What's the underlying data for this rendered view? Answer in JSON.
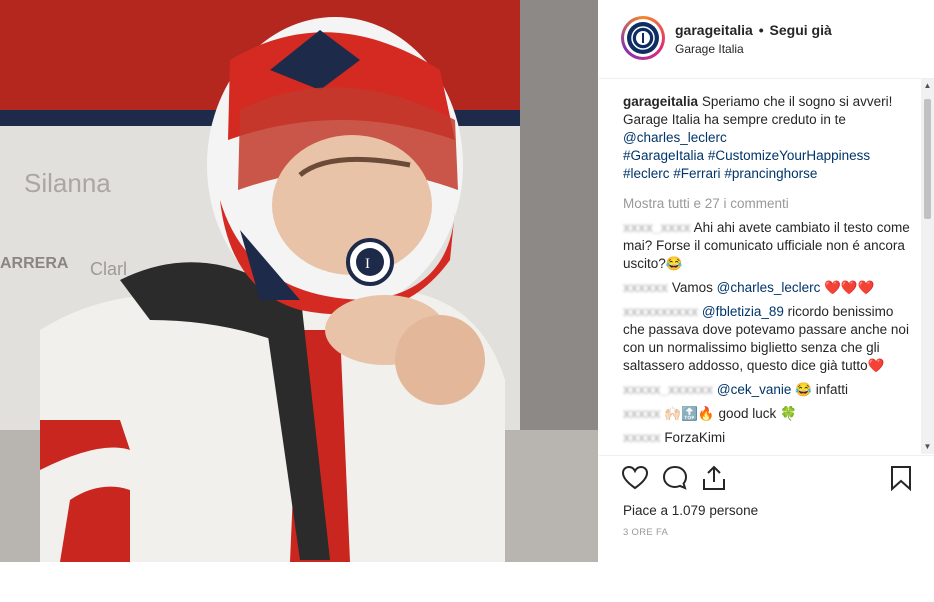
{
  "header": {
    "username": "garageitalia",
    "separator": "•",
    "follow_label": "Segui già",
    "subtitle": "Garage Italia"
  },
  "caption": {
    "username": "garageitalia",
    "text": "Speriamo che il sogno si avveri! Garage Italia ha sempre creduto in te",
    "mention": "@charles_leclerc",
    "hashtags": [
      "#GarageItalia",
      "#CustomizeYourHappiness",
      "#leclerc",
      "#Ferrari",
      "#prancinghorse"
    ]
  },
  "comments": {
    "view_all": "Mostra tutti e 27 i commenti",
    "items": [
      {
        "user": "xxxx_xxxx",
        "text": "Ahi ahi avete cambiato il testo come mai? Forse il comunicato ufficiale non é ancora uscito?😂"
      },
      {
        "user": "xxxxxx",
        "text": "Vamos",
        "mention": "@charles_leclerc",
        "suffix": "❤️❤️❤️"
      },
      {
        "user": "xxxxxxxxxx",
        "mention": "@fbletizia_89",
        "text": "ricordo benissimo che passava dove potevamo passare anche noi con un normalissimo biglietto senza che gli saltassero addosso, questo dice già tutto❤️"
      },
      {
        "user": "xxxxx_xxxxxx",
        "mention": "@cek_vanie",
        "text": "😂 infatti"
      },
      {
        "user": "xxxxx",
        "text": "🙌🏻🔝🔥 good luck 🍀"
      },
      {
        "user": "xxxxx",
        "text": "ForzaKimi"
      }
    ]
  },
  "actions": {
    "icons": [
      "heart-icon",
      "comment-icon",
      "share-icon",
      "bookmark-icon"
    ],
    "likes_text": "Piace a 1.079 persone",
    "timestamp": "3 ORE FA"
  },
  "colors": {
    "link": "#003569",
    "muted": "#999999",
    "text": "#262626",
    "divider": "#efefef"
  }
}
